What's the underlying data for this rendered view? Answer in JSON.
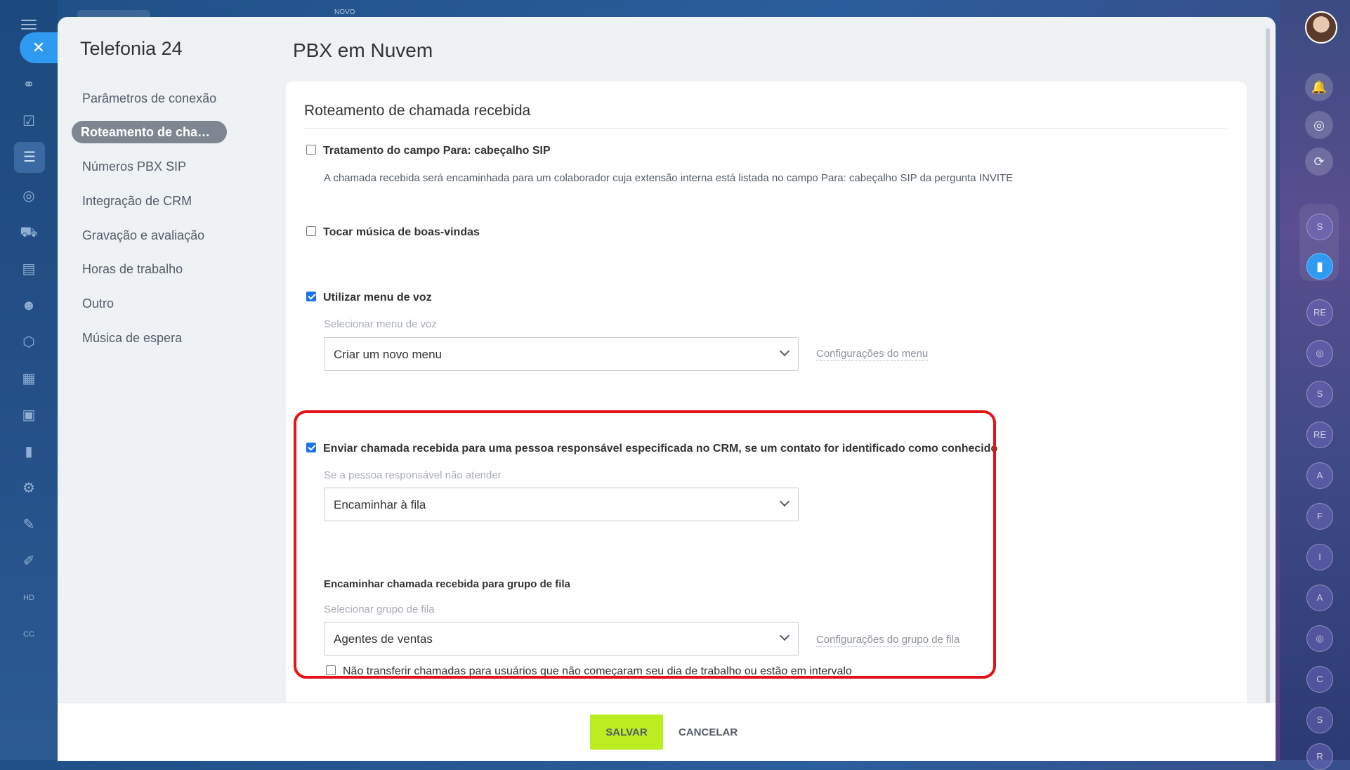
{
  "topbar": {
    "new_label": "NOVO"
  },
  "leftbar": {
    "icons": [
      "menu-icon",
      "close-icon",
      "sitemap-icon",
      "task-icon",
      "filter-icon",
      "target-icon",
      "cart-icon",
      "contact-card-icon",
      "robot-icon",
      "box-icon",
      "building-icon",
      "calendar-icon",
      "chart-icon",
      "settings-icon",
      "document-icon",
      "pen-icon",
      "hd-icon",
      "cc-icon"
    ]
  },
  "nav": {
    "title": "Telefonia 24",
    "items": [
      {
        "label": "Parâmetros de conexão"
      },
      {
        "label": "Roteamento de chamada recebida"
      },
      {
        "label": "Números PBX SIP"
      },
      {
        "label": "Integração de CRM"
      },
      {
        "label": "Gravação e avaliação"
      },
      {
        "label": "Horas de trabalho"
      },
      {
        "label": "Outro"
      },
      {
        "label": "Música de espera"
      }
    ]
  },
  "page": {
    "title": "PBX em Nuvem"
  },
  "section": {
    "title": "Roteamento de chamada recebida",
    "sip_header": {
      "label": "Tratamento do campo Para: cabeçalho SIP",
      "checked": false,
      "hint": "A chamada recebida será encaminhada para um colaborador cuja extensão interna está listada no campo Para: cabeçalho SIP da pergunta INVITE"
    },
    "welcome_music": {
      "label": "Tocar música de boas-vindas",
      "checked": false
    },
    "voice_menu": {
      "label": "Utilizar menu de voz",
      "checked": true,
      "select_label": "Selecionar menu de voz",
      "selected": "Criar um novo menu",
      "settings_link": "Configurações do menu"
    },
    "crm_responsible": {
      "label": "Enviar chamada recebida para uma pessoa responsável especificada no CRM, se um contato for identificado como conhecido",
      "checked": true,
      "if_no_answer_label": "Se a pessoa responsável não atender",
      "if_no_answer_selected": "Encaminhar à fila"
    },
    "queue": {
      "label": "Encaminhar chamada recebida para grupo de fila",
      "select_label": "Selecionar grupo de fila",
      "selected": "Agentes de ventas",
      "settings_link": "Configurações do grupo de fila",
      "no_transfer_label": "Não transferir chamadas para usuários que não começaram seu dia de trabalho ou estão em intervalo",
      "no_transfer_checked": false
    }
  },
  "footer": {
    "save": "SALVAR",
    "cancel": "CANCELAR"
  },
  "rightbar": {
    "circles": [
      "S",
      "",
      "RE",
      "",
      "S",
      "RE",
      "A",
      "F",
      "I",
      "A",
      "",
      "C",
      "S",
      "R"
    ]
  },
  "colors": {
    "accent": "#2f9bf0",
    "save_button": "#bbed21",
    "highlight": "#e3131a",
    "checkbox": "#1a73e8"
  }
}
